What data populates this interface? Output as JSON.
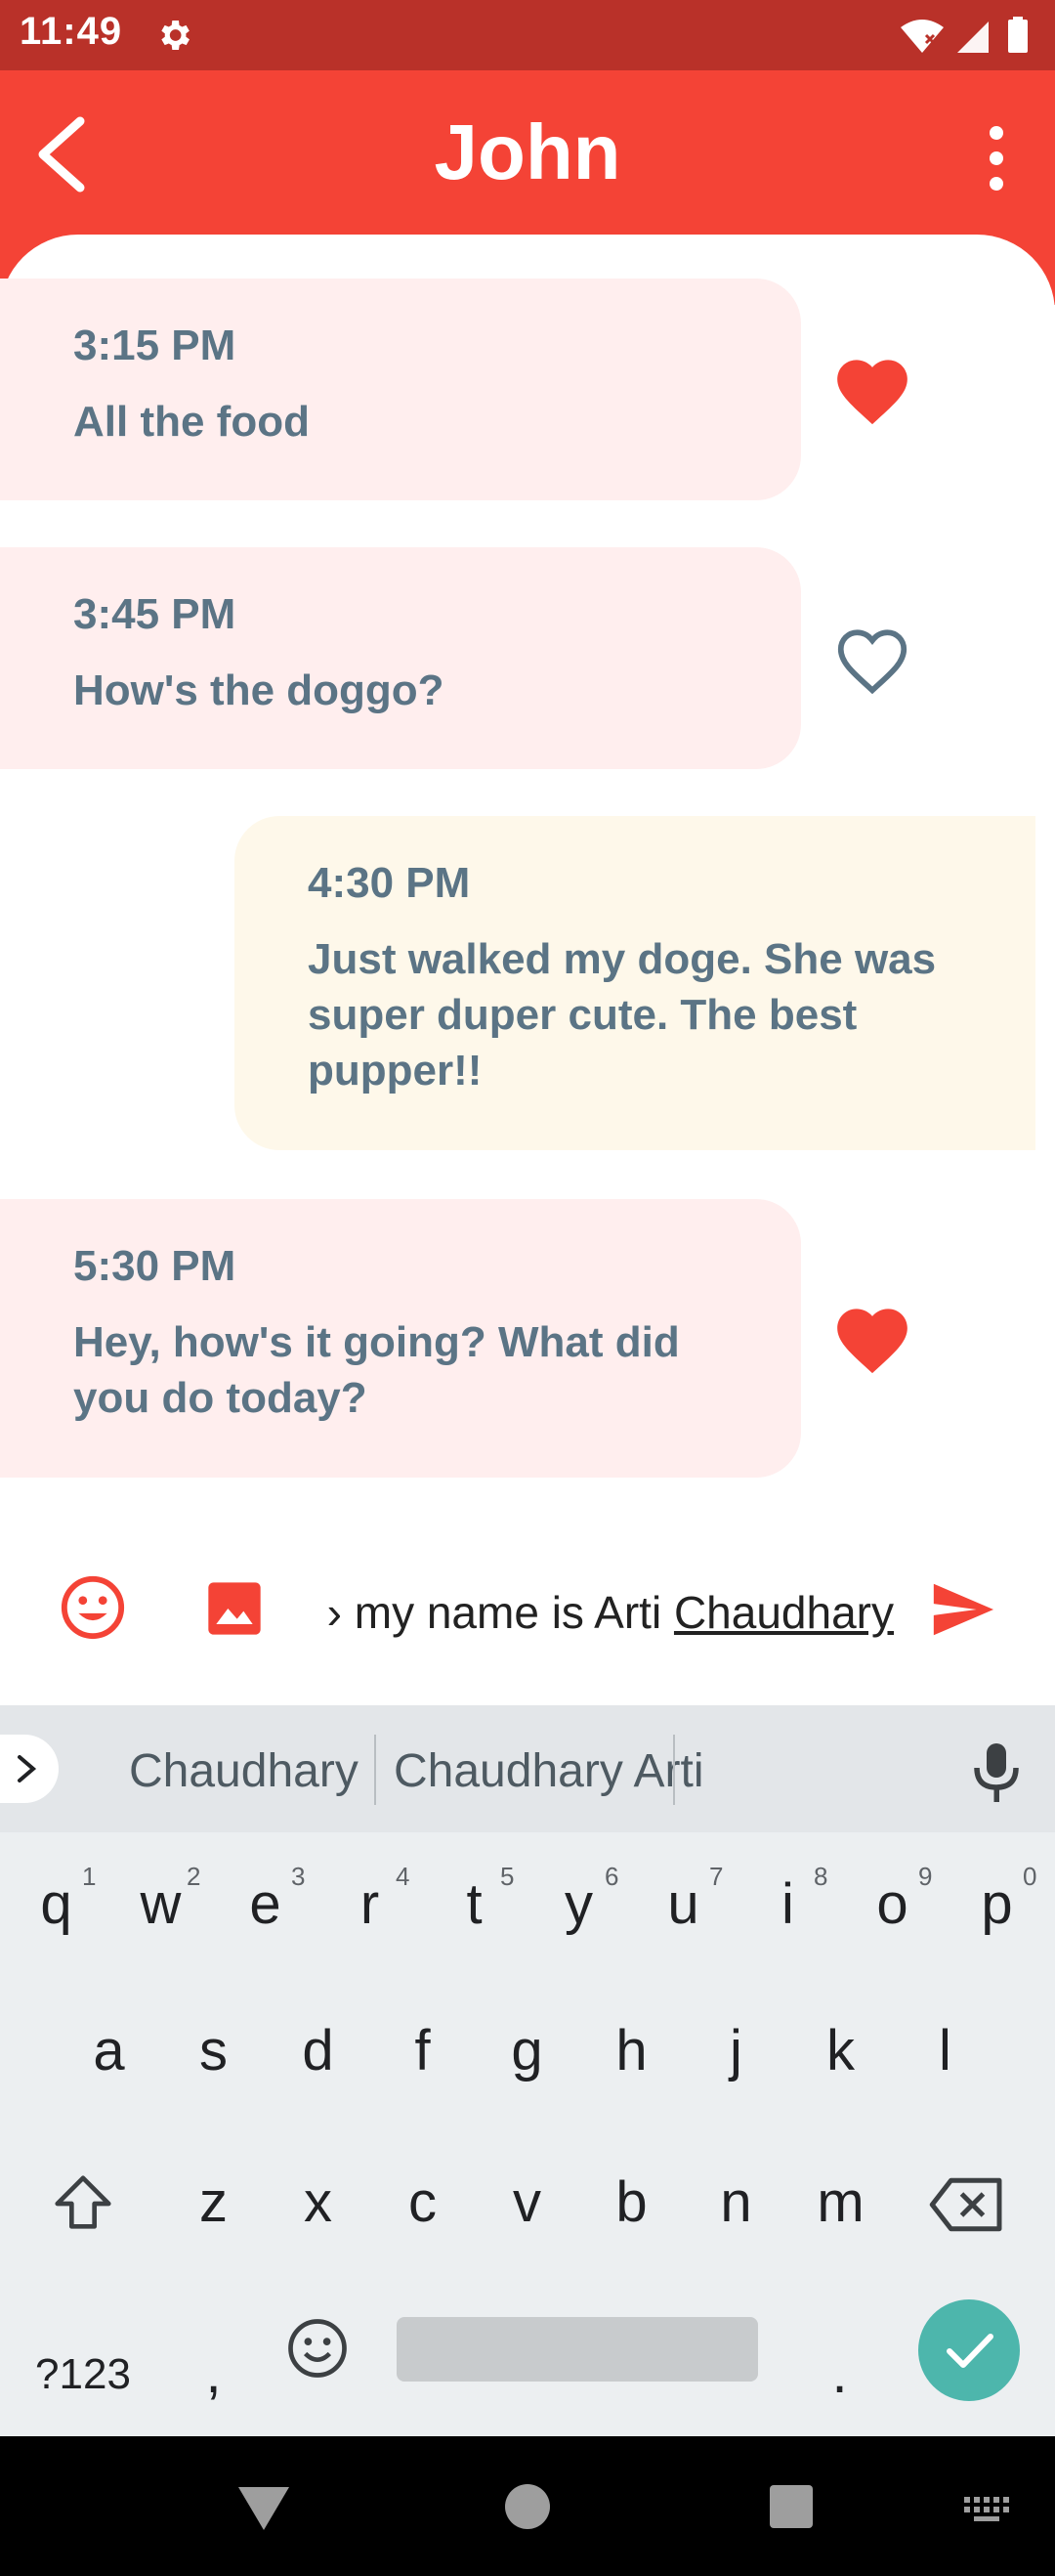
{
  "status_bar": {
    "time": "11:49"
  },
  "app_bar": {
    "title": "John"
  },
  "messages": [
    {
      "time": "3:15 PM",
      "text": "All the food",
      "liked": true
    },
    {
      "time": "3:45 PM",
      "text": "How's the doggo?",
      "liked": false
    },
    {
      "time": "4:30 PM",
      "text": "Just walked my doge. She was super duper cute. The best pupper!!"
    },
    {
      "time": "5:30 PM",
      "text": "Hey, how's it going? What did you do today?",
      "liked": true
    }
  ],
  "composer": {
    "text_prefix": "› my name is Arti ",
    "text_underlined": "Chaudhary"
  },
  "keyboard": {
    "suggestions": [
      "Chaudhary",
      "Chaudhary Arti"
    ],
    "row1": [
      "q",
      "w",
      "e",
      "r",
      "t",
      "y",
      "u",
      "i",
      "o",
      "p"
    ],
    "row1_hints": [
      "1",
      "2",
      "3",
      "4",
      "5",
      "6",
      "7",
      "8",
      "9",
      "0"
    ],
    "row2": [
      "a",
      "s",
      "d",
      "f",
      "g",
      "h",
      "j",
      "k",
      "l"
    ],
    "row3": [
      "z",
      "x",
      "c",
      "v",
      "b",
      "n",
      "m"
    ],
    "symbols_label": "?123",
    "comma": ",",
    "period": "."
  },
  "colors": {
    "status_bar": "#b93129",
    "app_bar": "#f44336",
    "incoming_bubble": "#ffeeee",
    "outgoing_bubble": "#fef8ea",
    "bubble_text": "#5b7485",
    "heart": "#f44336",
    "done_key": "#4db6ac"
  }
}
